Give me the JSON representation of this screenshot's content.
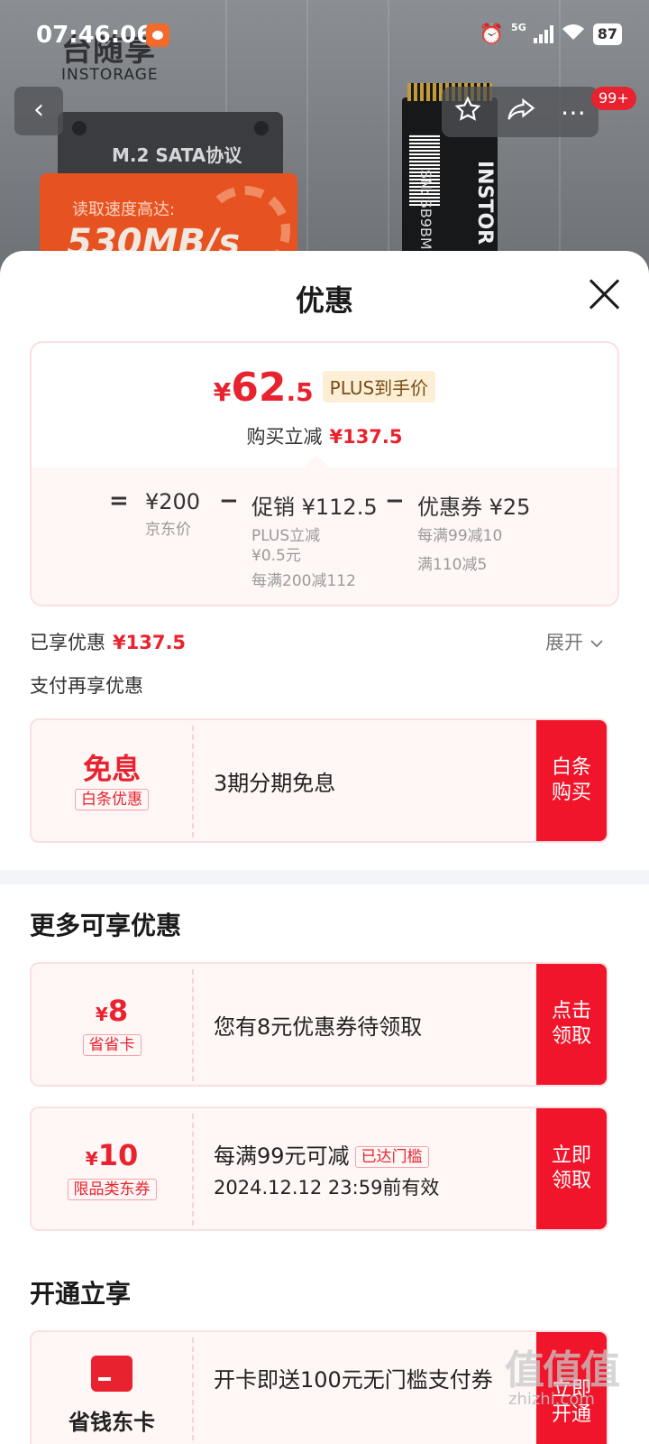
{
  "status_bar": {
    "time": "07:46:06",
    "network": "5G",
    "battery": "87"
  },
  "product_bg": {
    "brand_cn": "台随享",
    "brand_en": "INSTORAGE",
    "protocol": "M.2 SATA协议",
    "speed_label": "读取速度高达:",
    "speed_value": "530MB/s",
    "ssd_sn": "SN: SB9BMIN",
    "ssd_brand": "INSTOR"
  },
  "nav": {
    "back_icon": "chevron-left-icon",
    "badge": "99+"
  },
  "sheet": {
    "title": "优惠"
  },
  "price": {
    "currency": "¥",
    "integer": "62",
    "decimal": ".5",
    "plus_tag": "PLUS到手价",
    "reduce_label": "购买立减",
    "reduce_amount": "¥137.5"
  },
  "breakdown": {
    "eq": "=",
    "minus": "−",
    "jd_price": "¥200",
    "jd_label": "京东价",
    "promo": "促销 ¥112.5",
    "promo_sub1": "PLUS立减",
    "promo_sub2": "¥0.5元",
    "promo_sub3": "每满200减112",
    "coupon": "优惠券 ¥25",
    "coupon_sub1": "每满99减10",
    "coupon_sub2": "满110减5"
  },
  "enjoyed": {
    "label": "已享优惠",
    "amount": "¥137.5",
    "expand": "展开"
  },
  "pay_more": "支付再享优惠",
  "baitiao": {
    "title": "免息",
    "tag": "白条优惠",
    "desc": "3期分期免息",
    "button": "白条 购买"
  },
  "more_title": "更多可享优惠",
  "saver_card": {
    "currency": "¥",
    "value": "8",
    "tag": "省省卡",
    "desc": "您有8元优惠券待领取",
    "button": "点击 领取"
  },
  "dong_coupon": {
    "currency": "¥",
    "value": "10",
    "tag": "限品类东券",
    "desc": "每满99元可减",
    "met": "已达门槛",
    "valid": "2024.12.12 23:59前有效",
    "button": "立即 领取"
  },
  "open_title": "开通立享",
  "open_card": {
    "name": "省钱东卡",
    "desc": "开卡即送100元无门槛支付券",
    "button": "立即 开通"
  },
  "watermark": {
    "main": "值值值",
    "sub": "zhizhi.com"
  },
  "colors": {
    "accent": "#e8232f",
    "button": "#f0152a",
    "plus_bg": "#fcefd6"
  }
}
